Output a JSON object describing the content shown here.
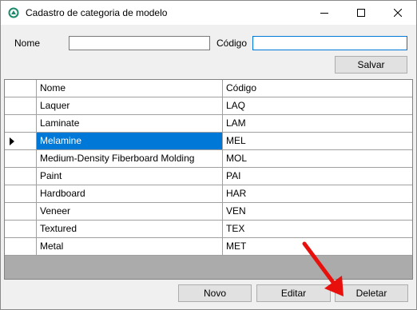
{
  "window": {
    "title": "Cadastro de categoria de modelo",
    "app_icon": "form-app-icon",
    "controls": [
      "minimize-icon",
      "maximize-icon",
      "close-icon"
    ]
  },
  "form": {
    "nome_label": "Nome",
    "nome_value": "",
    "codigo_label": "Código",
    "codigo_value": "",
    "save_label": "Salvar"
  },
  "grid": {
    "columns": [
      "Nome",
      "Código"
    ],
    "rows": [
      {
        "nome": "Laquer",
        "codigo": "LAQ"
      },
      {
        "nome": "Laminate",
        "codigo": "LAM"
      },
      {
        "nome": "Melamine",
        "codigo": "MEL"
      },
      {
        "nome": "Medium-Density Fiberboard Molding",
        "codigo": "MOL"
      },
      {
        "nome": "Paint",
        "codigo": "PAI"
      },
      {
        "nome": "Hardboard",
        "codigo": "HAR"
      },
      {
        "nome": "Veneer",
        "codigo": "VEN"
      },
      {
        "nome": "Textured",
        "codigo": "TEX"
      },
      {
        "nome": "Metal",
        "codigo": "MET"
      }
    ],
    "selected_row_index": 2,
    "selection_color": "#0078d7"
  },
  "actions": {
    "novo_label": "Novo",
    "editar_label": "Editar",
    "deletar_label": "Deletar"
  },
  "annotation": {
    "arrow_color": "#e8100c",
    "arrow_icon": "red-pointer-arrow-icon"
  }
}
